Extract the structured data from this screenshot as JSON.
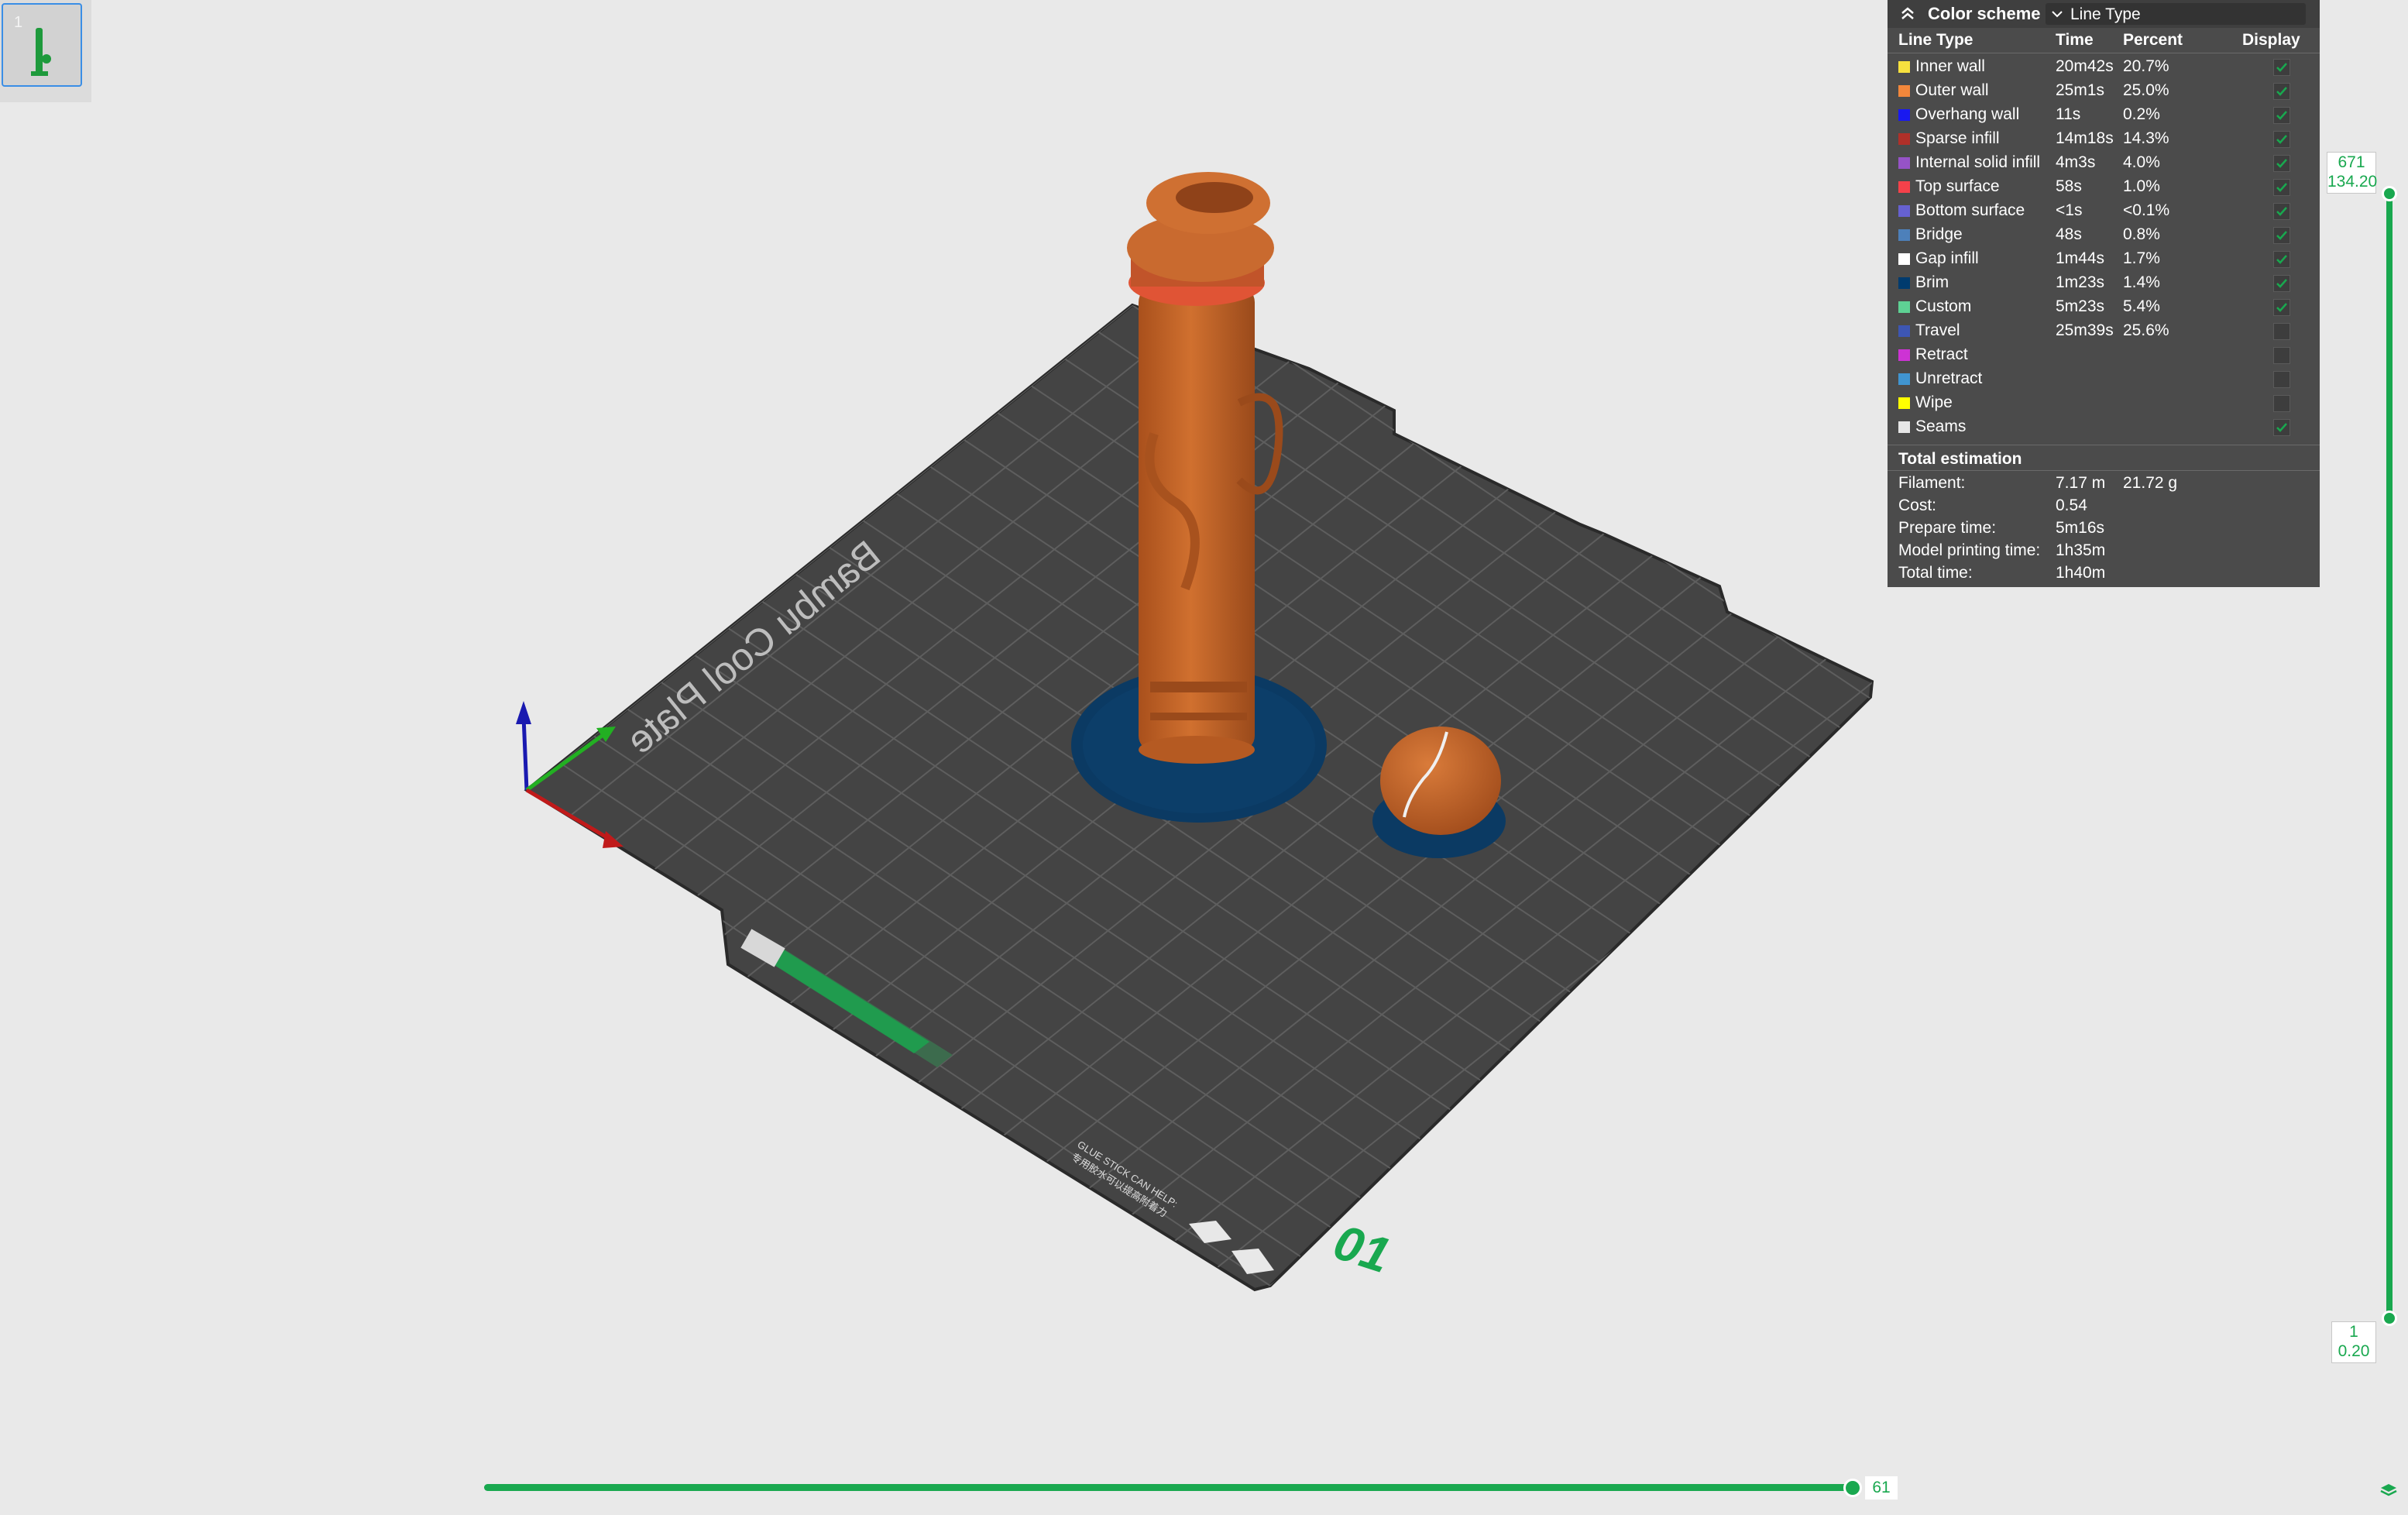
{
  "thumbnail": {
    "number": "1"
  },
  "plate": {
    "label": "Bambu Cool Plate",
    "number": "01",
    "glue_text_1": "GLUE STICK CAN HELP:",
    "glue_text_2": "专用胶水可以提高附着力"
  },
  "legend": {
    "title": "Color scheme",
    "scheme_value": "Line Type",
    "col_type": "Line Type",
    "col_time": "Time",
    "col_percent": "Percent",
    "col_display": "Display",
    "rows": [
      {
        "name": "Inner wall",
        "time": "20m42s",
        "percent": "20.7%",
        "color": "#f7e13e",
        "checked": true
      },
      {
        "name": "Outer wall",
        "time": "25m1s",
        "percent": "25.0%",
        "color": "#f2873b",
        "checked": true
      },
      {
        "name": "Overhang wall",
        "time": "11s",
        "percent": "0.2%",
        "color": "#1919f0",
        "checked": true
      },
      {
        "name": "Sparse infill",
        "time": "14m18s",
        "percent": "14.3%",
        "color": "#b03029",
        "checked": true
      },
      {
        "name": "Internal solid infill",
        "time": "4m3s",
        "percent": "4.0%",
        "color": "#9653c7",
        "checked": true
      },
      {
        "name": "Top surface",
        "time": "58s",
        "percent": "1.0%",
        "color": "#f5414a",
        "checked": true
      },
      {
        "name": "Bottom surface",
        "time": "<1s",
        "percent": "<0.1%",
        "color": "#6661d1",
        "checked": true
      },
      {
        "name": "Bridge",
        "time": "48s",
        "percent": "0.8%",
        "color": "#4d80ba",
        "checked": true
      },
      {
        "name": "Gap infill",
        "time": "1m44s",
        "percent": "1.7%",
        "color": "#ffffff",
        "checked": true
      },
      {
        "name": "Brim",
        "time": "1m23s",
        "percent": "1.4%",
        "color": "#003b6e",
        "checked": true
      },
      {
        "name": "Custom",
        "time": "5m23s",
        "percent": "5.4%",
        "color": "#5ed194",
        "checked": true
      },
      {
        "name": "Travel",
        "time": "25m39s",
        "percent": "25.6%",
        "color": "#3d56b3",
        "checked": false
      },
      {
        "name": "Retract",
        "time": "",
        "percent": "",
        "color": "#cd33d4",
        "checked": false
      },
      {
        "name": "Unretract",
        "time": "",
        "percent": "",
        "color": "#4095d1",
        "checked": false
      },
      {
        "name": "Wipe",
        "time": "",
        "percent": "",
        "color": "#ffff00",
        "checked": false
      },
      {
        "name": "Seams",
        "time": "",
        "percent": "",
        "color": "#e6e6e6",
        "checked": true
      }
    ],
    "total_title": "Total estimation",
    "totals": {
      "filament_label": "Filament:",
      "filament_len": "7.17 m",
      "filament_weight": "21.72 g",
      "cost_label": "Cost:",
      "cost": "0.54",
      "prepare_label": "Prepare time:",
      "prepare": "5m16s",
      "model_label": "Model printing time:",
      "model": "1h35m",
      "total_label": "Total time:",
      "total": "1h40m"
    }
  },
  "layer_slider": {
    "top_layer": "671",
    "top_height": "134.20",
    "bottom_layer": "1",
    "bottom_height": "0.20"
  },
  "move_slider": {
    "value": "61"
  },
  "colors": {
    "accent": "#19a84f",
    "model": "#c8662a",
    "brim": "#0b3a63",
    "plate": "#424242",
    "background": "#e9e9e9"
  }
}
